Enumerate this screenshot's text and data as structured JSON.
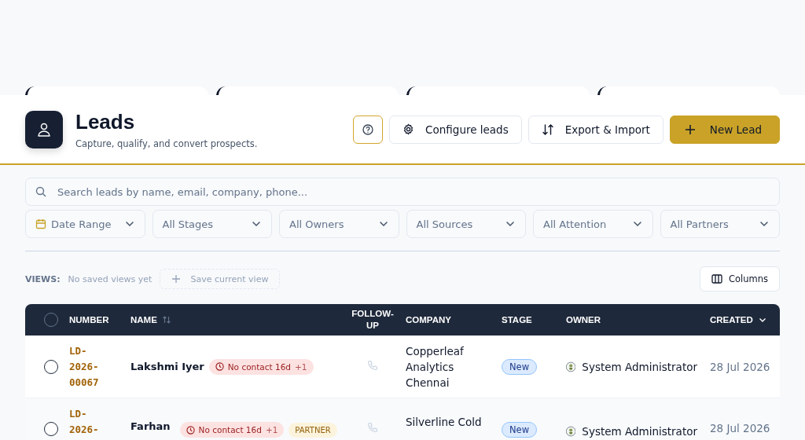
{
  "header": {
    "title": "Leads",
    "subtitle": "Capture, qualify, and convert prospects.",
    "buttons": [
      {
        "kind": "help"
      },
      {
        "kind": "configure",
        "label": "Configure leads"
      },
      {
        "kind": "export",
        "label": "Export & Import"
      },
      {
        "kind": "new",
        "label": "New Lead"
      }
    ]
  },
  "search": {
    "placeholder": "Search leads by name, email, company, phone..."
  },
  "filters": [
    {
      "kind": "date",
      "label": "Date Range"
    },
    {
      "kind": "select",
      "label": "All Stages"
    },
    {
      "kind": "select",
      "label": "All Owners"
    },
    {
      "kind": "select",
      "label": "All Sources"
    },
    {
      "kind": "select",
      "label": "All Attention"
    },
    {
      "kind": "select",
      "label": "All Partners"
    }
  ],
  "views": {
    "label": "VIEWS:",
    "empty": "No saved views yet",
    "save": "Save current view",
    "columns": "Columns"
  },
  "table": {
    "all_checked": false,
    "columns": [
      {
        "label": "NUMBER",
        "kind": "plain"
      },
      {
        "label": "NAME",
        "kind": "sortable"
      },
      {
        "label": "FOLLOW-UP",
        "kind": "plain"
      },
      {
        "label": "COMPANY",
        "kind": "plain"
      },
      {
        "label": "STAGE",
        "kind": "plain"
      },
      {
        "label": "OWNER",
        "kind": "plain"
      },
      {
        "label": "CREATED",
        "kind": "sorted"
      }
    ],
    "rows": [
      {
        "checked": false,
        "number": "LD-2026-00067",
        "name": "Lakshmi Iyer",
        "badges": [
          {
            "kind": "alert",
            "text": "No contact 16d",
            "extra": "+1"
          }
        ],
        "company": "Copperleaf Analytics Chennai",
        "stage": "New",
        "owner": "System Administrator",
        "created": "28 Jul 2026"
      },
      {
        "checked": false,
        "number": "LD-2026-",
        "name": "Farhan",
        "badges": [
          {
            "kind": "alert",
            "text": "No contact 16d",
            "extra": "+1"
          },
          {
            "kind": "partner",
            "text": "PARTNER"
          }
        ],
        "company": "Silverline Cold",
        "stage": "New",
        "owner": "System Administrator",
        "created": "28 Jul 2026"
      }
    ]
  }
}
